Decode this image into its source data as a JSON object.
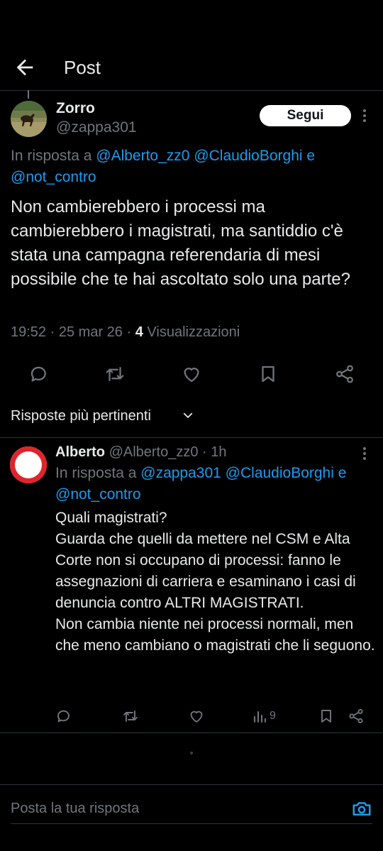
{
  "header": {
    "title": "Post"
  },
  "post": {
    "author_name": "Zorro",
    "author_handle": "@zappa301",
    "follow_label": "Segui",
    "reply_prefix": "In risposta a",
    "reply_to": [
      "@Alberto_zz0",
      "@ClaudioBorghi",
      "@not_contro"
    ],
    "reply_joiner": "e",
    "body": "Non cambierebbero i processi ma cambierebbero i magistrati, ma santiddio c'è stata una campagna referendaria di mesi possibile che te hai ascoltato solo una parte?",
    "time": "19:52",
    "date": "25 mar 26",
    "views_count": "4",
    "views_label": "Visualizzazioni",
    "separator": "·"
  },
  "sort": {
    "label": "Risposte più pertinenti"
  },
  "reply": {
    "author_name": "Alberto",
    "author_handle": "@Alberto_zz0",
    "age": "1h",
    "separator": "·",
    "reply_prefix": "In risposta a",
    "reply_to": [
      "@zappa301",
      "@ClaudioBorghi",
      "@not_contro"
    ],
    "reply_joiner": "e",
    "body_lines": [
      "Quali magistrati?",
      "Guarda che quelli da mettere nel CSM e Alta Corte non si occupano di processi: fanno le assegnazioni di carriera e esaminano i casi di denuncia contro ALTRI MAGISTRATI.",
      "Non cambia niente nei processi normali, men che meno cambiano o magistrati che li seguono."
    ],
    "views_count": "9"
  },
  "composer": {
    "placeholder": "Posta la tua risposta"
  },
  "colors": {
    "background": "#000000",
    "text": "#e7e9ea",
    "muted": "#71767b",
    "link": "#1d9bf0",
    "divider": "#2f3336",
    "avatar_ring": "#e0242b"
  },
  "icons": [
    "back-arrow-icon",
    "more-icon",
    "reply-icon",
    "retweet-icon",
    "like-icon",
    "bookmark-icon",
    "share-icon",
    "chevron-down-icon",
    "views-icon",
    "camera-icon"
  ]
}
